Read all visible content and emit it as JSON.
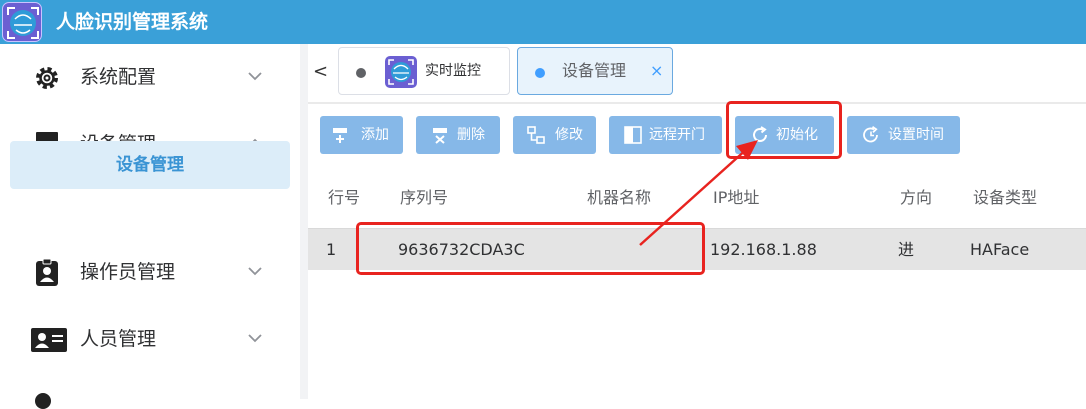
{
  "app": {
    "title": "人脸识别管理系统"
  },
  "sidebar": {
    "items": [
      {
        "label": "系统配置",
        "icon": "gear-icon",
        "expanded": false
      },
      {
        "label": "设备管理",
        "icon": "monitor-icon",
        "expanded": true
      },
      {
        "label": "操作员管理",
        "icon": "id-badge-icon",
        "expanded": false
      },
      {
        "label": "人员管理",
        "icon": "id-card-icon",
        "expanded": false
      }
    ],
    "active_subitem": "设备管理"
  },
  "tabs": [
    {
      "label": "实时监控",
      "active": false
    },
    {
      "label": "设备管理",
      "active": true,
      "close": "×"
    }
  ],
  "toolbar": {
    "buttons": [
      {
        "label": "添加",
        "icon": "add-icon"
      },
      {
        "label": "删除",
        "icon": "delete-icon"
      },
      {
        "label": "修改",
        "icon": "edit-icon"
      },
      {
        "label": "远程开门",
        "icon": "door-icon"
      },
      {
        "label": "初始化",
        "icon": "refresh-icon"
      },
      {
        "label": "设置时间",
        "icon": "clock-refresh-icon"
      }
    ]
  },
  "table": {
    "columns": [
      "行号",
      "序列号",
      "机器名称",
      "IP地址",
      "方向",
      "设备类型"
    ],
    "rows": [
      [
        "1",
        "9636732CDA3C",
        "",
        "192.168.1.88",
        "进",
        "HAFace"
      ]
    ]
  },
  "colors": {
    "header": "#3aa0d8",
    "accent": "#409eff",
    "button": "#86b8e8",
    "highlight": "#e8231f"
  }
}
